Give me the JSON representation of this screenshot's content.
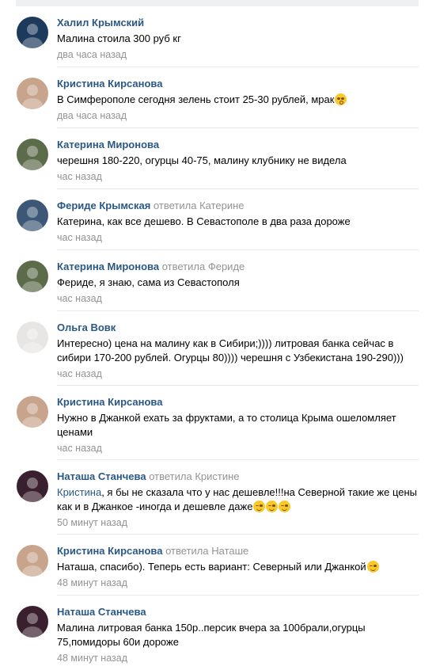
{
  "comments": [
    {
      "author": "Халил Крымский",
      "reply_label": "",
      "reply_to": "",
      "text_prefix": "",
      "text": "Малина стоила 300 руб кг",
      "emojis": [],
      "time": "два часа назад",
      "avatar_color": "#1d3a5c"
    },
    {
      "author": "Кристина Кирсанова",
      "reply_label": "",
      "reply_to": "",
      "text_prefix": "",
      "text": "В Симферополе сегодня зелень стоит 25-30 рублей, мрак",
      "emojis": [
        "shocked"
      ],
      "time": "два часа назад",
      "avatar_color": "#c8a48c"
    },
    {
      "author": "Катерина Миронова",
      "reply_label": "",
      "reply_to": "",
      "text_prefix": "",
      "text": "черешня 180-220, огурцы 40-75, малину клубнику не видела",
      "emojis": [],
      "time": "час назад",
      "avatar_color": "#5c6b4a"
    },
    {
      "author": "Фериде Крымская",
      "reply_label": "ответила",
      "reply_to": "Катерине",
      "text_prefix": "",
      "text": "Катерина, как все дешево. В Севастополе в два раза дороже",
      "emojis": [],
      "time": "час назад",
      "avatar_color": "#3d5877"
    },
    {
      "author": "Катерина Миронова",
      "reply_label": "ответила",
      "reply_to": "Фериде",
      "text_prefix": "",
      "text": "Фериде, я знаю, сама из Севастополя",
      "emojis": [],
      "time": "час назад",
      "avatar_color": "#5c6b4a"
    },
    {
      "author": "Ольга Вовк",
      "reply_label": "",
      "reply_to": "",
      "text_prefix": "",
      "text": "Интересно) цена на малину как в Сибири;)))) литровая банка сейчас в сибири 170-200 рублей. Огурцы 80)))) черешня с Узбекистана 190-290)))",
      "emojis": [],
      "time": "час назад",
      "avatar_color": "#e8e6e4",
      "tall": true
    },
    {
      "author": "Кристина Кирсанова",
      "reply_label": "",
      "reply_to": "",
      "text_prefix": "",
      "text": "Нужно в Джанкой ехать за фруктами, а то столица Крыма ошеломляет ценами",
      "emojis": [],
      "time": "час назад",
      "avatar_color": "#c8a48c",
      "tall": true
    },
    {
      "author": "Наташа Станчева",
      "reply_label": "ответила",
      "reply_to": "Кристине",
      "text_prefix": "Кристина",
      "text": ", я бы не сказала что у нас дешевле!!!на Северной такие же цены как и в Джанкое -иногда и дешевле даже",
      "emojis": [
        "wink",
        "wink",
        "wink"
      ],
      "time": "50 минут назад",
      "avatar_color": "#3a1f2e",
      "tall": true
    },
    {
      "author": "Кристина Кирсанова",
      "reply_label": "ответила",
      "reply_to": "Наташе",
      "text_prefix": "",
      "text": "Наташа, спасибо). Теперь есть вариант: Северный или Джанкой",
      "emojis": [
        "wink"
      ],
      "time": "48 минут назад",
      "avatar_color": "#c8a48c"
    },
    {
      "author": "Наташа Станчева",
      "reply_label": "",
      "reply_to": "",
      "text_prefix": "",
      "text": "Малина литровая банка 150р..персик вчера за 100брали,огурцы 75,помидоры 60и дороже",
      "emojis": [],
      "time": "48 минут назад",
      "avatar_color": "#3a1f2e",
      "tall": true
    }
  ]
}
